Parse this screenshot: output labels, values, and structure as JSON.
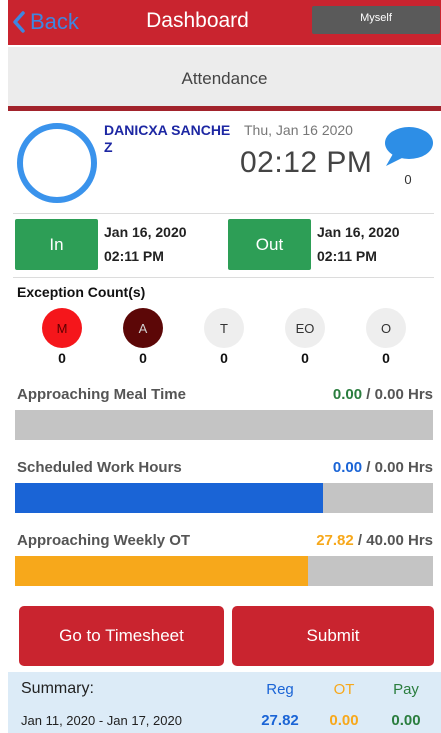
{
  "header": {
    "back_label": "Back",
    "title": "Dashboard",
    "user_menu": "Myself"
  },
  "section": {
    "title": "Attendance"
  },
  "user": {
    "name": "DANICXA SANCHEZ",
    "date": "Thu, Jan 16 2020",
    "time": "02:12 PM",
    "message_count": "0"
  },
  "punch": {
    "in": {
      "label": "In",
      "date": "Jan 16, 2020",
      "time": "02:11 PM"
    },
    "out": {
      "label": "Out",
      "date": "Jan 16, 2020",
      "time": "02:11 PM"
    }
  },
  "exceptions": {
    "title": "Exception Count(s)",
    "items": [
      {
        "code": "M",
        "count": "0",
        "color": "#f5161b"
      },
      {
        "code": "A",
        "count": "0",
        "color": "#5c0707"
      },
      {
        "code": "T",
        "count": "0",
        "color": "#eeeeee"
      },
      {
        "code": "EO",
        "count": "0",
        "color": "#eeeeee"
      },
      {
        "code": "O",
        "count": "0",
        "color": "#eeeeee"
      }
    ]
  },
  "progress": [
    {
      "label": "Approaching Meal Time",
      "value": "0.00",
      "total": "0.00",
      "unit": "Hrs",
      "fraction": 0,
      "color": "#2a7d3e"
    },
    {
      "label": "Scheduled Work Hours",
      "value": "0.00",
      "total": "0.00",
      "unit": "Hrs",
      "fraction": 0.737,
      "color": "#1a64d6"
    },
    {
      "label": "Approaching Weekly OT",
      "value": "27.82",
      "total": "40.00",
      "unit": "Hrs",
      "fraction": 0.7,
      "color": "#f7a81b"
    }
  ],
  "actions": {
    "timesheet": "Go to Timesheet",
    "submit": "Submit"
  },
  "summary": {
    "label": "Summary:",
    "columns": [
      {
        "name": "Reg",
        "color": "#1a64d6"
      },
      {
        "name": "OT",
        "color": "#f7a81b"
      },
      {
        "name": "Pay",
        "color": "#2a7d3e"
      }
    ],
    "period": "Jan 11, 2020 - Jan 17, 2020",
    "reg": "27.82",
    "ot": "0.00",
    "pay": "0.00"
  },
  "colors": {
    "header": "#c9242f",
    "accent_blue": "#3f86e0",
    "green": "#2d9e56"
  }
}
